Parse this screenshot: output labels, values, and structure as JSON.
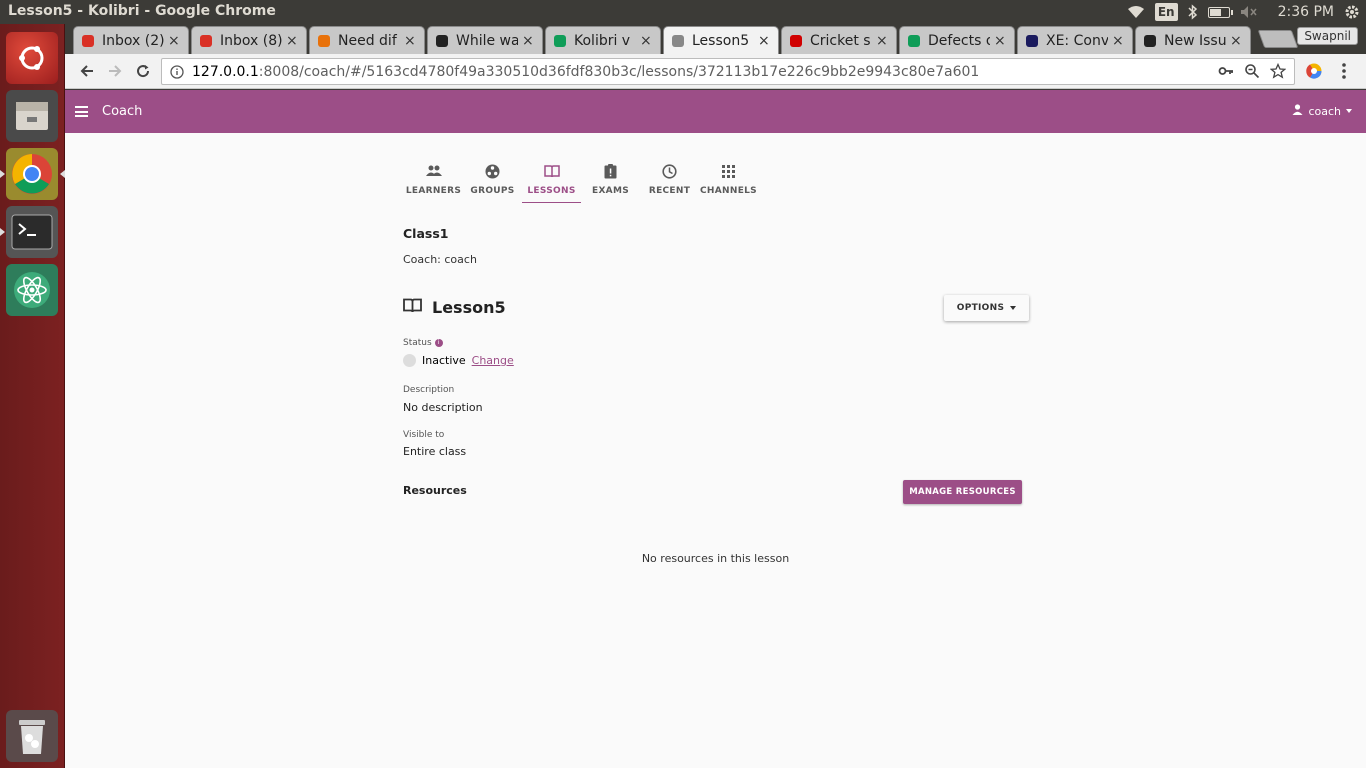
{
  "os": {
    "window_title": "Lesson5 - Kolibri - Google Chrome",
    "keyboard_layout": "En",
    "clock": "2:36 PM"
  },
  "launcher": {
    "items": [
      "ubuntu-dash",
      "files",
      "chrome",
      "terminal",
      "atom"
    ],
    "trash": "trash"
  },
  "browser": {
    "tabs": [
      {
        "label": "Inbox (2)",
        "icon": "gmail-icon",
        "color": "#d93025"
      },
      {
        "label": "Inbox (8)",
        "icon": "gmail-icon",
        "color": "#d93025"
      },
      {
        "label": "Need dif",
        "icon": "colorful-icon",
        "color": "#e8710a"
      },
      {
        "label": "While wa",
        "icon": "github-icon",
        "color": "#222222"
      },
      {
        "label": "Kolibri v",
        "icon": "sheets-icon",
        "color": "#0f9d58"
      },
      {
        "label": "Lesson5",
        "icon": "broadcast-icon",
        "color": "#888888"
      },
      {
        "label": "Cricket s",
        "icon": "cricket-icon",
        "color": "#d00000"
      },
      {
        "label": "Defects o",
        "icon": "sheets-icon",
        "color": "#0f9d58"
      },
      {
        "label": "XE: Conv",
        "icon": "xe-icon",
        "color": "#1a1a5e"
      },
      {
        "label": "New Issu",
        "icon": "github-icon",
        "color": "#222222"
      }
    ],
    "active_tab": 5,
    "profile_name": "Swapnil",
    "url_host": "127.0.0.1",
    "url_path": ":8008/coach/#/5163cd4780f49a330510d36fdf830b3c/lessons/372113b17e226c9bb2e9943c80e7a601"
  },
  "app": {
    "title": "Coach",
    "user": "coach",
    "brand_color": "#9c4e87",
    "nav": [
      {
        "label": "LEARNERS",
        "icon": "people-icon"
      },
      {
        "label": "GROUPS",
        "icon": "groups-icon"
      },
      {
        "label": "LESSONS",
        "icon": "book-icon"
      },
      {
        "label": "EXAMS",
        "icon": "exam-icon"
      },
      {
        "label": "RECENT",
        "icon": "clock-icon"
      },
      {
        "label": "CHANNELS",
        "icon": "grid-icon"
      }
    ],
    "active_nav": "LESSONS",
    "class_name": "Class1",
    "coach_line": "Coach: coach",
    "lesson_title": "Lesson5",
    "options_label": "OPTIONS",
    "status_label": "Status",
    "status_value": "Inactive",
    "change_label": "Change",
    "description_label": "Description",
    "description_value": "No description",
    "visible_label": "Visible to",
    "visible_value": "Entire class",
    "resources_label": "Resources",
    "manage_label": "MANAGE RESOURCES",
    "empty_message": "No resources in this lesson"
  }
}
